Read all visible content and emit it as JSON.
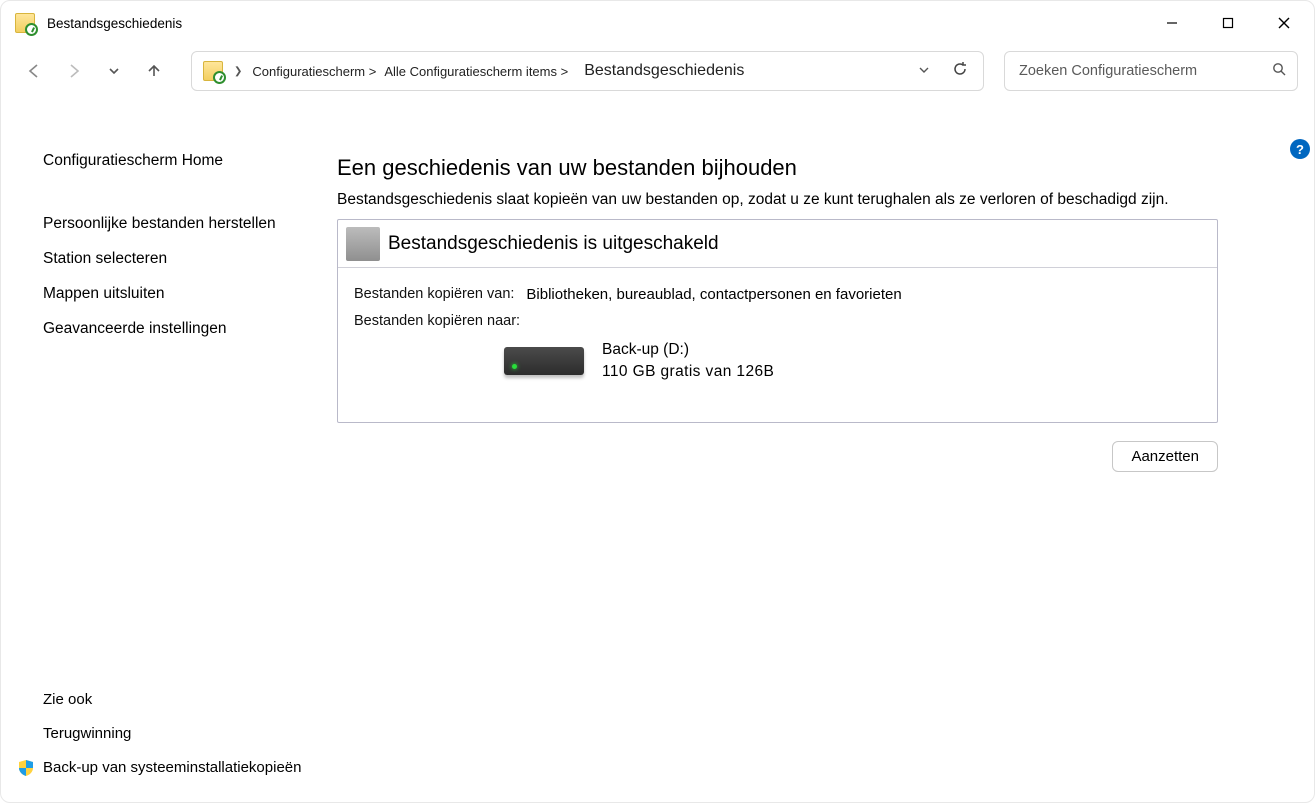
{
  "window": {
    "title": "Bestandsgeschiedenis"
  },
  "breadcrumbs": {
    "seg1": "Configuratiescherm >",
    "seg2": "Alle Configuratiescherm items >",
    "seg3": "Bestandsgeschiedenis"
  },
  "search": {
    "placeholder": "Zoeken Configuratiescherm"
  },
  "sidebar": {
    "home": "Configuratiescherm Home",
    "link1": "Persoonlijke bestanden herstellen",
    "link2": "Station selecteren",
    "link3": "Mappen uitsluiten",
    "link4": "Geavanceerde instellingen"
  },
  "seealso": {
    "header": "Zie ook",
    "link1": "Terugwinning",
    "link2": "Back-up van systeeminstallatiekopieën"
  },
  "main": {
    "heading": "Een geschiedenis van uw bestanden bijhouden",
    "desc": "Bestandsgeschiedenis slaat kopieën van uw bestanden op, zodat u ze kunt terughalen als ze verloren of beschadigd zijn.",
    "status": "Bestandsgeschiedenis is uitgeschakeld",
    "copy_from_label": "Bestanden kopiëren van:",
    "copy_from_value": "Bibliotheken, bureaublad, contactpersonen en favorieten",
    "copy_to_label": "Bestanden kopiëren naar:",
    "drive_name": "Back-up (D:)",
    "drive_free": "110 GB",
    "drive_free_suffix": "gratis van 126B",
    "turn_on": "Aanzetten"
  },
  "help_badge": "?"
}
